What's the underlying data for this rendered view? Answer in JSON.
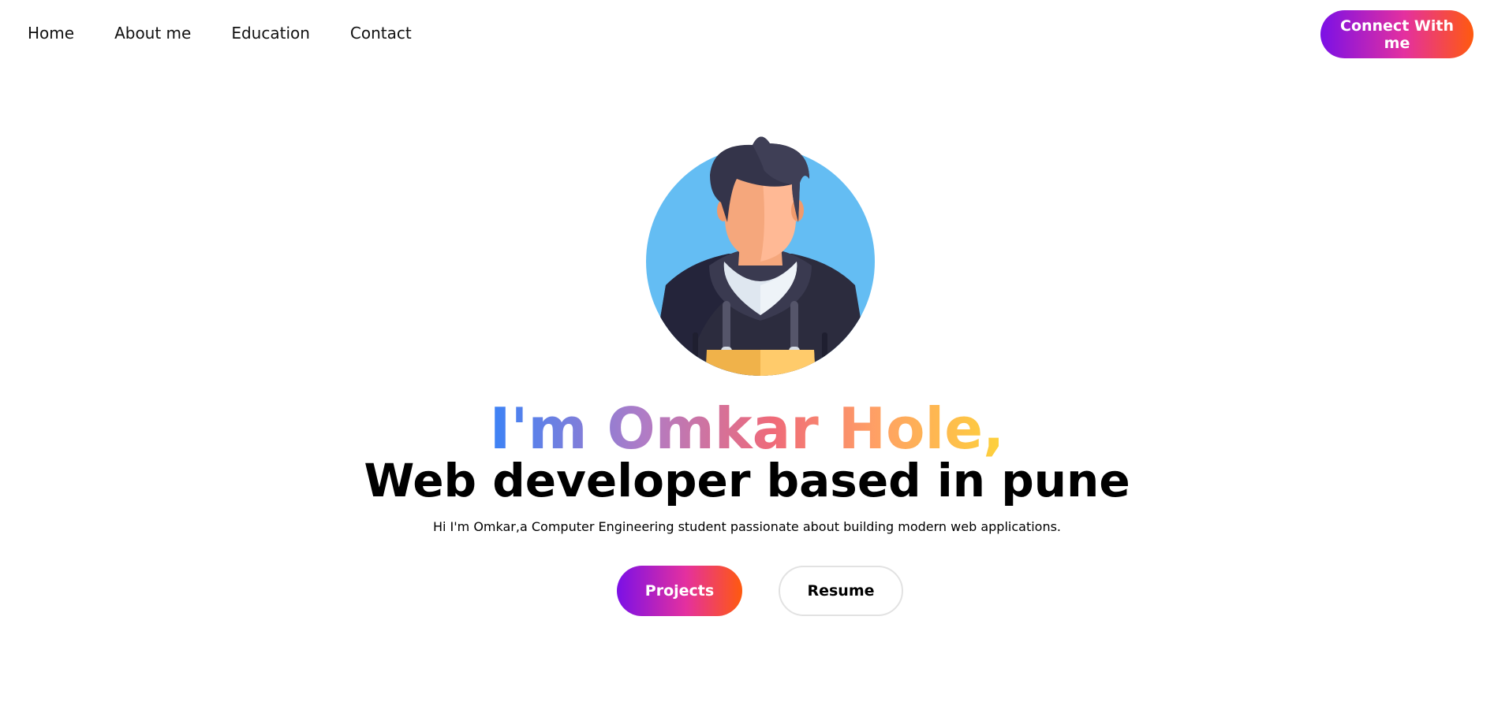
{
  "nav": {
    "links": [
      {
        "label": "Home"
      },
      {
        "label": "About me"
      },
      {
        "label": "Education"
      },
      {
        "label": "Contact"
      }
    ],
    "connect_label": "Connect With me"
  },
  "hero": {
    "title": "I'm Omkar Hole,",
    "subtitle": "Web developer based in pune",
    "intro": "Hi I'm Omkar,a Computer Engineering student passionate about building modern web applications.",
    "projects_label": "Projects",
    "resume_label": "Resume",
    "avatar_icon": "developer-avatar-icon"
  },
  "colors": {
    "button_gradient": [
      "#7b10e6",
      "#e4309f",
      "#ff5a0e"
    ],
    "title_gradient": [
      "#3b82f6",
      "#b07cc6",
      "#ef6a79",
      "#ffa065",
      "#fdd23b"
    ],
    "avatar_bg": "#64bdf3"
  }
}
